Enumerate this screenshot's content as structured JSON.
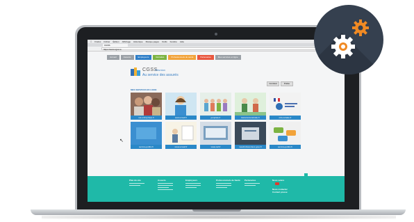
{
  "browser": {
    "menu_items": [
      "Firefox",
      "Fichier",
      "Édition",
      "Affichage",
      "Historique",
      "Marque-pages",
      "Outils",
      "Fenêtre",
      "Aide"
    ],
    "tab_label": "CGSS",
    "url": "https://www.cgss.re"
  },
  "site": {
    "nav_items": [
      {
        "label": "Accueil",
        "color": "#9aa0a6"
      },
      {
        "label": "Assurés",
        "color": "#9aa0a6"
      },
      {
        "label": "Employeurs",
        "color": "#2f7fc8"
      },
      {
        "label": "Retraités",
        "color": "#7cb342"
      },
      {
        "label": "Professionnels de santé",
        "color": "#f2a33a"
      },
      {
        "label": "Partenaires",
        "color": "#e9573f"
      },
      {
        "label": "Mes services en ligne",
        "color": "#9aa0a6"
      }
    ],
    "logo_title": "CGSS",
    "logo_region": "Réunion",
    "logo_tagline": "Au service des assurés",
    "btn_left": "Contrast",
    "btn_right": "Police",
    "section_title": "MES SERVICES EN LIGNE"
  },
  "tiles": [
    {
      "caption": "net-entreprises.fr",
      "color": "#2a88c8"
    },
    {
      "caption": "www.ameli.fr",
      "color": "#2a88c8"
    },
    {
      "caption": "jemplois.fr",
      "color": "#2a88c8"
    },
    {
      "caption": "lassuranceretraite.fr",
      "color": "#2a88c8"
    },
    {
      "caption": "info-retraite.fr",
      "color": "#2a88c8"
    },
    {
      "caption": "service-public.fr",
      "color": "#2a88c8"
    },
    {
      "caption": "www.urssaf.fr",
      "color": "#2a88c8"
    },
    {
      "caption": "www.caf.fr",
      "color": "#2a88c8"
    },
    {
      "caption": "mesdroitssociaux.gouv.fr",
      "color": "#2a88c8"
    },
    {
      "caption": "service-public.fr",
      "color": "#2a88c8"
    }
  ],
  "footer": {
    "col1": "Plan du site",
    "col2": "Assurés",
    "col3": "Employeurs",
    "col4": "Professionnels de Santé",
    "col5": "Partenaires",
    "col6": "Nous suivre",
    "contact1": "Nous contacter",
    "contact2": "Contact presse"
  },
  "colors": {
    "footer": "#1fb9a8",
    "badge": "#35404f",
    "gear_orange": "#f08a24",
    "gear_white": "#ffffff"
  }
}
